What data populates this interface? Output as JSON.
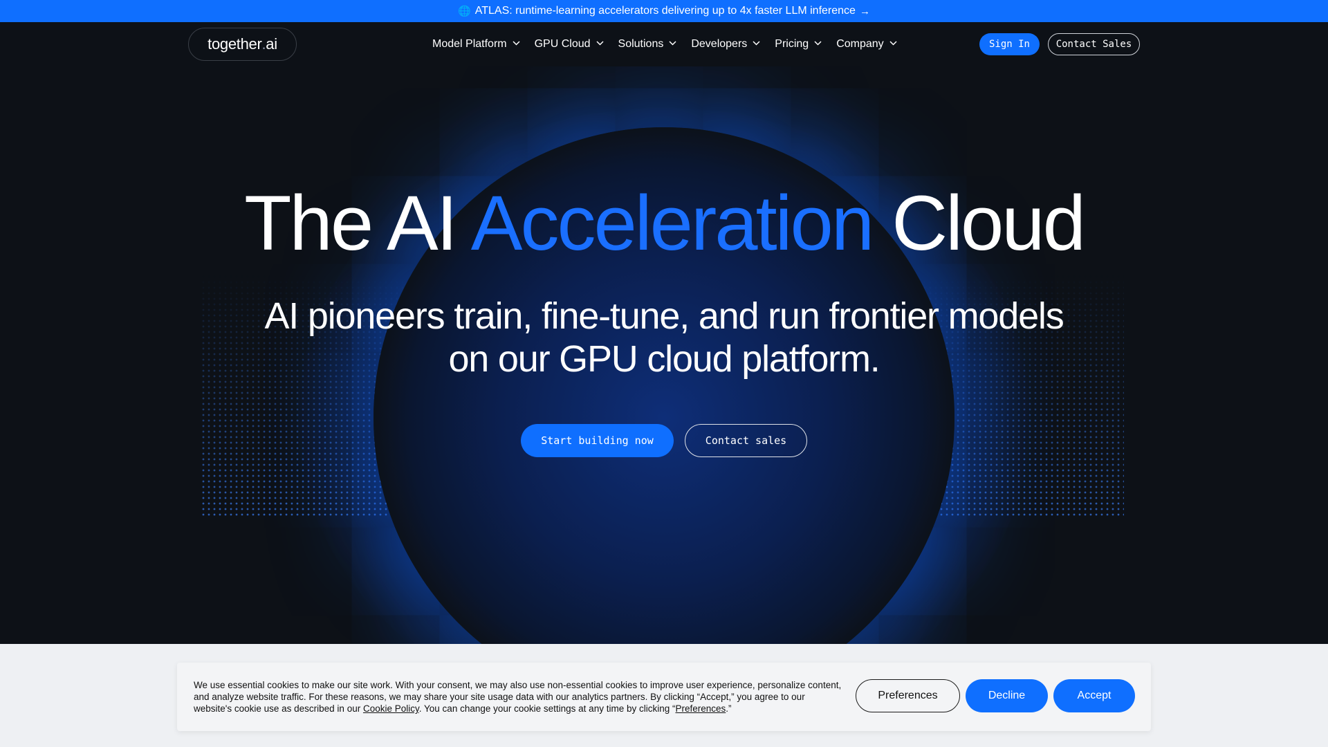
{
  "announcement": {
    "text": "ATLAS: runtime-learning accelerators delivering up to 4x faster LLM inference",
    "icon": "globe-icon",
    "arrow": "→"
  },
  "nav": {
    "logo_main": "together",
    "logo_dot": ".",
    "logo_tld": "ai",
    "items": [
      {
        "label": "Model Platform"
      },
      {
        "label": "GPU Cloud"
      },
      {
        "label": "Solutions"
      },
      {
        "label": "Developers"
      },
      {
        "label": "Pricing"
      },
      {
        "label": "Company"
      }
    ],
    "sign_in": "Sign In",
    "contact_sales": "Contact Sales"
  },
  "hero": {
    "headline_part1": "The AI ",
    "headline_accent": "Acceleration",
    "headline_part2": " Cloud",
    "subhead": "AI pioneers train, fine-tune, and run frontier models on our GPU cloud platform.",
    "cta_primary": "Start building now",
    "cta_secondary": "Contact sales"
  },
  "cookie": {
    "text_before_policy": "We use essential cookies to make our site work. With your consent, we may also use non-essential cookies to improve user experience, personalize content, and analyze website traffic. For these reasons, we may share your site usage data with our analytics partners. By clicking “Accept,” you agree to our website's cookie use as described in our ",
    "policy_link": "Cookie Policy",
    "text_middle": ". You can change your cookie settings at any time by clicking “",
    "preferences_link": "Preferences",
    "text_end": ".”",
    "preferences_button": "Preferences",
    "decline_button": "Decline",
    "accept_button": "Accept"
  },
  "colors": {
    "accent": "#0f6fff",
    "background": "#0d1117",
    "headline_accent": "#1a6fff"
  }
}
